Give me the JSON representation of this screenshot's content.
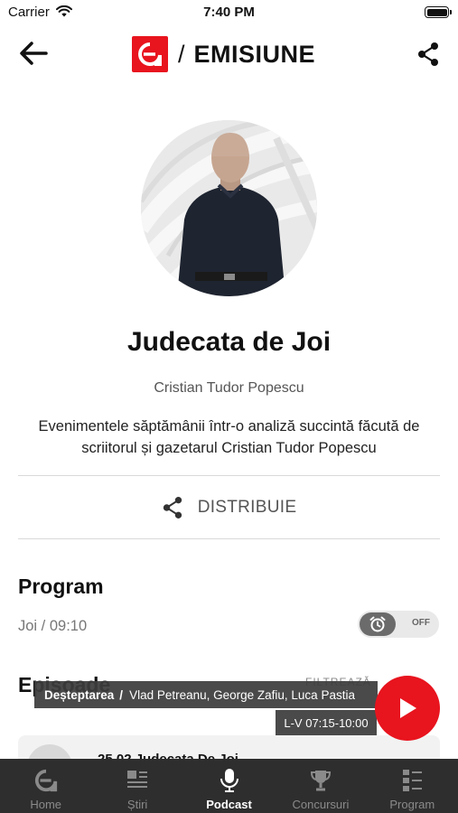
{
  "status_bar": {
    "carrier": "Carrier",
    "time": "7:40 PM"
  },
  "header": {
    "section": "EMISIUNE",
    "separator": "/"
  },
  "show": {
    "title": "Judecata de Joi",
    "author": "Cristian Tudor Popescu",
    "description": "Evenimentele săptămânii într-o analiză succintă făcută de scriitorul și gazetarul Cristian Tudor Popescu"
  },
  "share": {
    "label": "DISTRIBUIE"
  },
  "program": {
    "heading": "Program",
    "schedule": "Joi / 09:10",
    "reminder_state": "OFF"
  },
  "episodes": {
    "heading": "Episoade",
    "filter_label": "FILTREAZĂ",
    "first_title": "25.02 Judecata De Joi"
  },
  "now_playing": {
    "show": "Deșteptarea",
    "separator": "/",
    "hosts": "Vlad Petreanu, George Zafiu, Luca Pastia",
    "time": "L-V 07:15-10:00"
  },
  "tabs": [
    {
      "label": "Home",
      "icon": "europa-fm-icon",
      "active": false
    },
    {
      "label": "Știri",
      "icon": "news-icon",
      "active": false
    },
    {
      "label": "Podcast",
      "icon": "microphone-icon",
      "active": true
    },
    {
      "label": "Concursuri",
      "icon": "trophy-icon",
      "active": false
    },
    {
      "label": "Program",
      "icon": "schedule-icon",
      "active": false
    }
  ],
  "colors": {
    "brand_red": "#e8141e",
    "tab_bar": "#2e2e2e",
    "banner": "#3c3c3c"
  }
}
